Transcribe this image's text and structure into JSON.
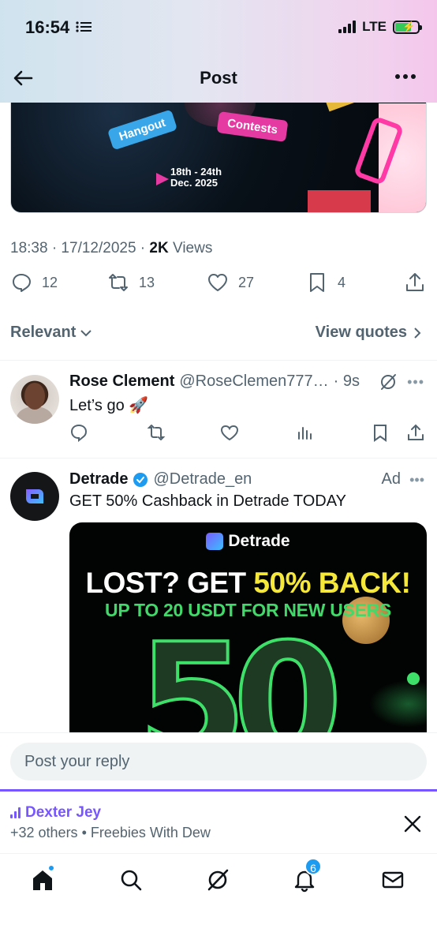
{
  "status": {
    "time": "16:54",
    "network": "LTE"
  },
  "header": {
    "title": "Post"
  },
  "post_media": {
    "tag_hangout": "Hangout",
    "tag_contests": "Contests",
    "date_line1": "18th - 24th",
    "date_line2": "Dec. 2025"
  },
  "post_meta": {
    "timestamp": "18:38 · 17/12/2025 ·",
    "views_count": "2K",
    "views_label": "Views"
  },
  "post_actions": {
    "replies": "12",
    "reposts": "13",
    "likes": "27",
    "bookmarks": "4"
  },
  "filters": {
    "sort_label": "Relevant",
    "quotes_label": "View quotes"
  },
  "reply": {
    "name": "Rose Clement",
    "handle": "@RoseClemen777…",
    "time": "· 9s",
    "text": "Let’s go 🚀"
  },
  "ad": {
    "name": "Detrade",
    "handle": "@Detrade_en",
    "label": "Ad",
    "text": "GET 50% Cashback  in Detrade TODAY",
    "media_logo": "Detrade",
    "media_headline_white": "LOST? GET ",
    "media_headline_yellow": "50% BACK!",
    "media_sub": "UP TO 20 USDT FOR NEW USERS",
    "media_big": "50"
  },
  "composer": {
    "placeholder": "Post your reply"
  },
  "space": {
    "host": "Dexter Jey",
    "subtitle": "+32 others • Freebies With Dew"
  },
  "nav": {
    "notifications_badge": "6"
  },
  "colors": {
    "accent": "#1d9bf0",
    "space_purple": "#7856ff",
    "verified": "#1d9bf0"
  }
}
